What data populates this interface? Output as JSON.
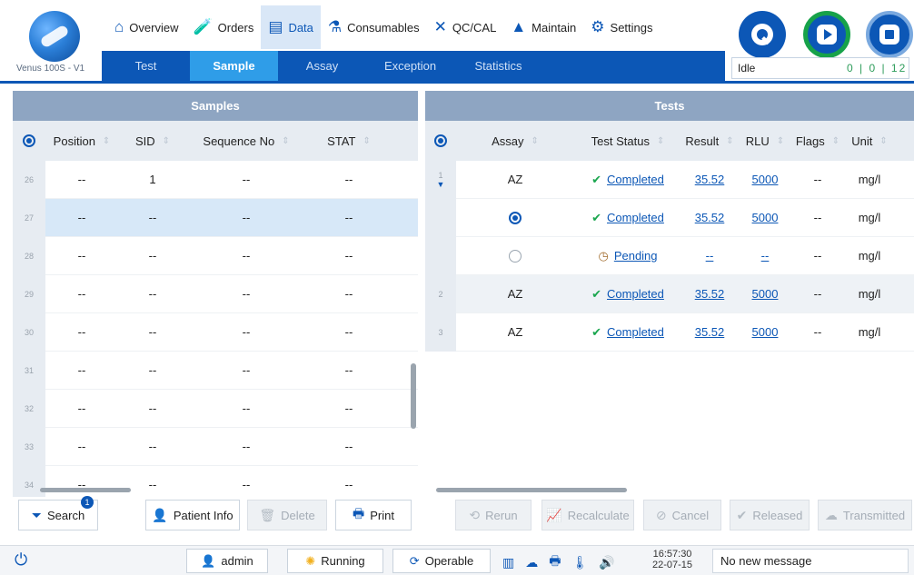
{
  "app": {
    "version": "Venus 100S - V1"
  },
  "main_nav": [
    {
      "label": "Overview",
      "icon": "home-icon",
      "glyph": "⌂",
      "active": false
    },
    {
      "label": "Orders",
      "icon": "test-tube-icon",
      "glyph": "🧪",
      "active": false
    },
    {
      "label": "Data",
      "icon": "clipboard-icon",
      "glyph": "▤",
      "active": true
    },
    {
      "label": "Consumables",
      "icon": "flask-icon",
      "glyph": "⚗",
      "active": false
    },
    {
      "label": "QC/CAL",
      "icon": "tools-icon",
      "glyph": "✕",
      "active": false
    },
    {
      "label": "Maintain",
      "icon": "warning-icon",
      "glyph": "▲",
      "active": false
    },
    {
      "label": "Settings",
      "icon": "gear-icon",
      "glyph": "⚙",
      "active": false
    }
  ],
  "sub_nav": [
    "Test",
    "Sample",
    "Assay",
    "Exception",
    "Statistics"
  ],
  "sub_nav_active": "Sample",
  "instrument": {
    "status": "Idle",
    "counts": "0 | 0 | 12"
  },
  "samples": {
    "title": "Samples",
    "columns": [
      "Position",
      "SID",
      "Sequence No",
      "STAT"
    ],
    "rows": [
      {
        "idx": "26",
        "position": "--",
        "sid": "1",
        "seq": "--",
        "stat": "--"
      },
      {
        "idx": "27",
        "position": "--",
        "sid": "--",
        "seq": "--",
        "stat": "--"
      },
      {
        "idx": "28",
        "position": "--",
        "sid": "--",
        "seq": "--",
        "stat": "--"
      },
      {
        "idx": "29",
        "position": "--",
        "sid": "--",
        "seq": "--",
        "stat": "--"
      },
      {
        "idx": "30",
        "position": "--",
        "sid": "--",
        "seq": "--",
        "stat": "--"
      },
      {
        "idx": "31",
        "position": "--",
        "sid": "--",
        "seq": "--",
        "stat": "--"
      },
      {
        "idx": "32",
        "position": "--",
        "sid": "--",
        "seq": "--",
        "stat": "--"
      },
      {
        "idx": "33",
        "position": "--",
        "sid": "--",
        "seq": "--",
        "stat": "--"
      },
      {
        "idx": "34",
        "position": "--",
        "sid": "--",
        "seq": "--",
        "stat": "--"
      }
    ],
    "buttons": {
      "search": "Search",
      "search_badge": "1",
      "patient_info": "Patient Info",
      "delete": "Delete",
      "print": "Print"
    }
  },
  "tests": {
    "title": "Tests",
    "columns": [
      "Assay",
      "Test Status",
      "Result",
      "RLU",
      "Flags",
      "Unit"
    ],
    "rows": [
      {
        "idx": "1",
        "assay": "AZ",
        "status": "Completed",
        "result": "35.52",
        "rlu": "5000",
        "flags": "--",
        "unit": "mg/l",
        "kind": "completed",
        "marker": "expand"
      },
      {
        "idx": "",
        "assay": "",
        "status": "Completed",
        "result": "35.52",
        "rlu": "5000",
        "flags": "--",
        "unit": "mg/l",
        "kind": "completed",
        "marker": "radio-on"
      },
      {
        "idx": "",
        "assay": "",
        "status": "Pending",
        "result": "--",
        "rlu": "--",
        "flags": "--",
        "unit": "mg/l",
        "kind": "pending",
        "marker": "radio-off"
      },
      {
        "idx": "2",
        "assay": "AZ",
        "status": "Completed",
        "result": "35.52",
        "rlu": "5000",
        "flags": "--",
        "unit": "mg/l",
        "kind": "completed",
        "marker": ""
      },
      {
        "idx": "3",
        "assay": "AZ",
        "status": "Completed",
        "result": "35.52",
        "rlu": "5000",
        "flags": "--",
        "unit": "mg/l",
        "kind": "completed",
        "marker": ""
      }
    ],
    "buttons": {
      "rerun": "Rerun",
      "recalculate": "Recalculate",
      "cancel": "Cancel",
      "released": "Released",
      "transmitted": "Transmitted"
    }
  },
  "bottom": {
    "user": "admin",
    "run_state": "Running",
    "operable": "Operable",
    "time": "16:57:30",
    "date": "22-07-15",
    "message": "No new message"
  }
}
